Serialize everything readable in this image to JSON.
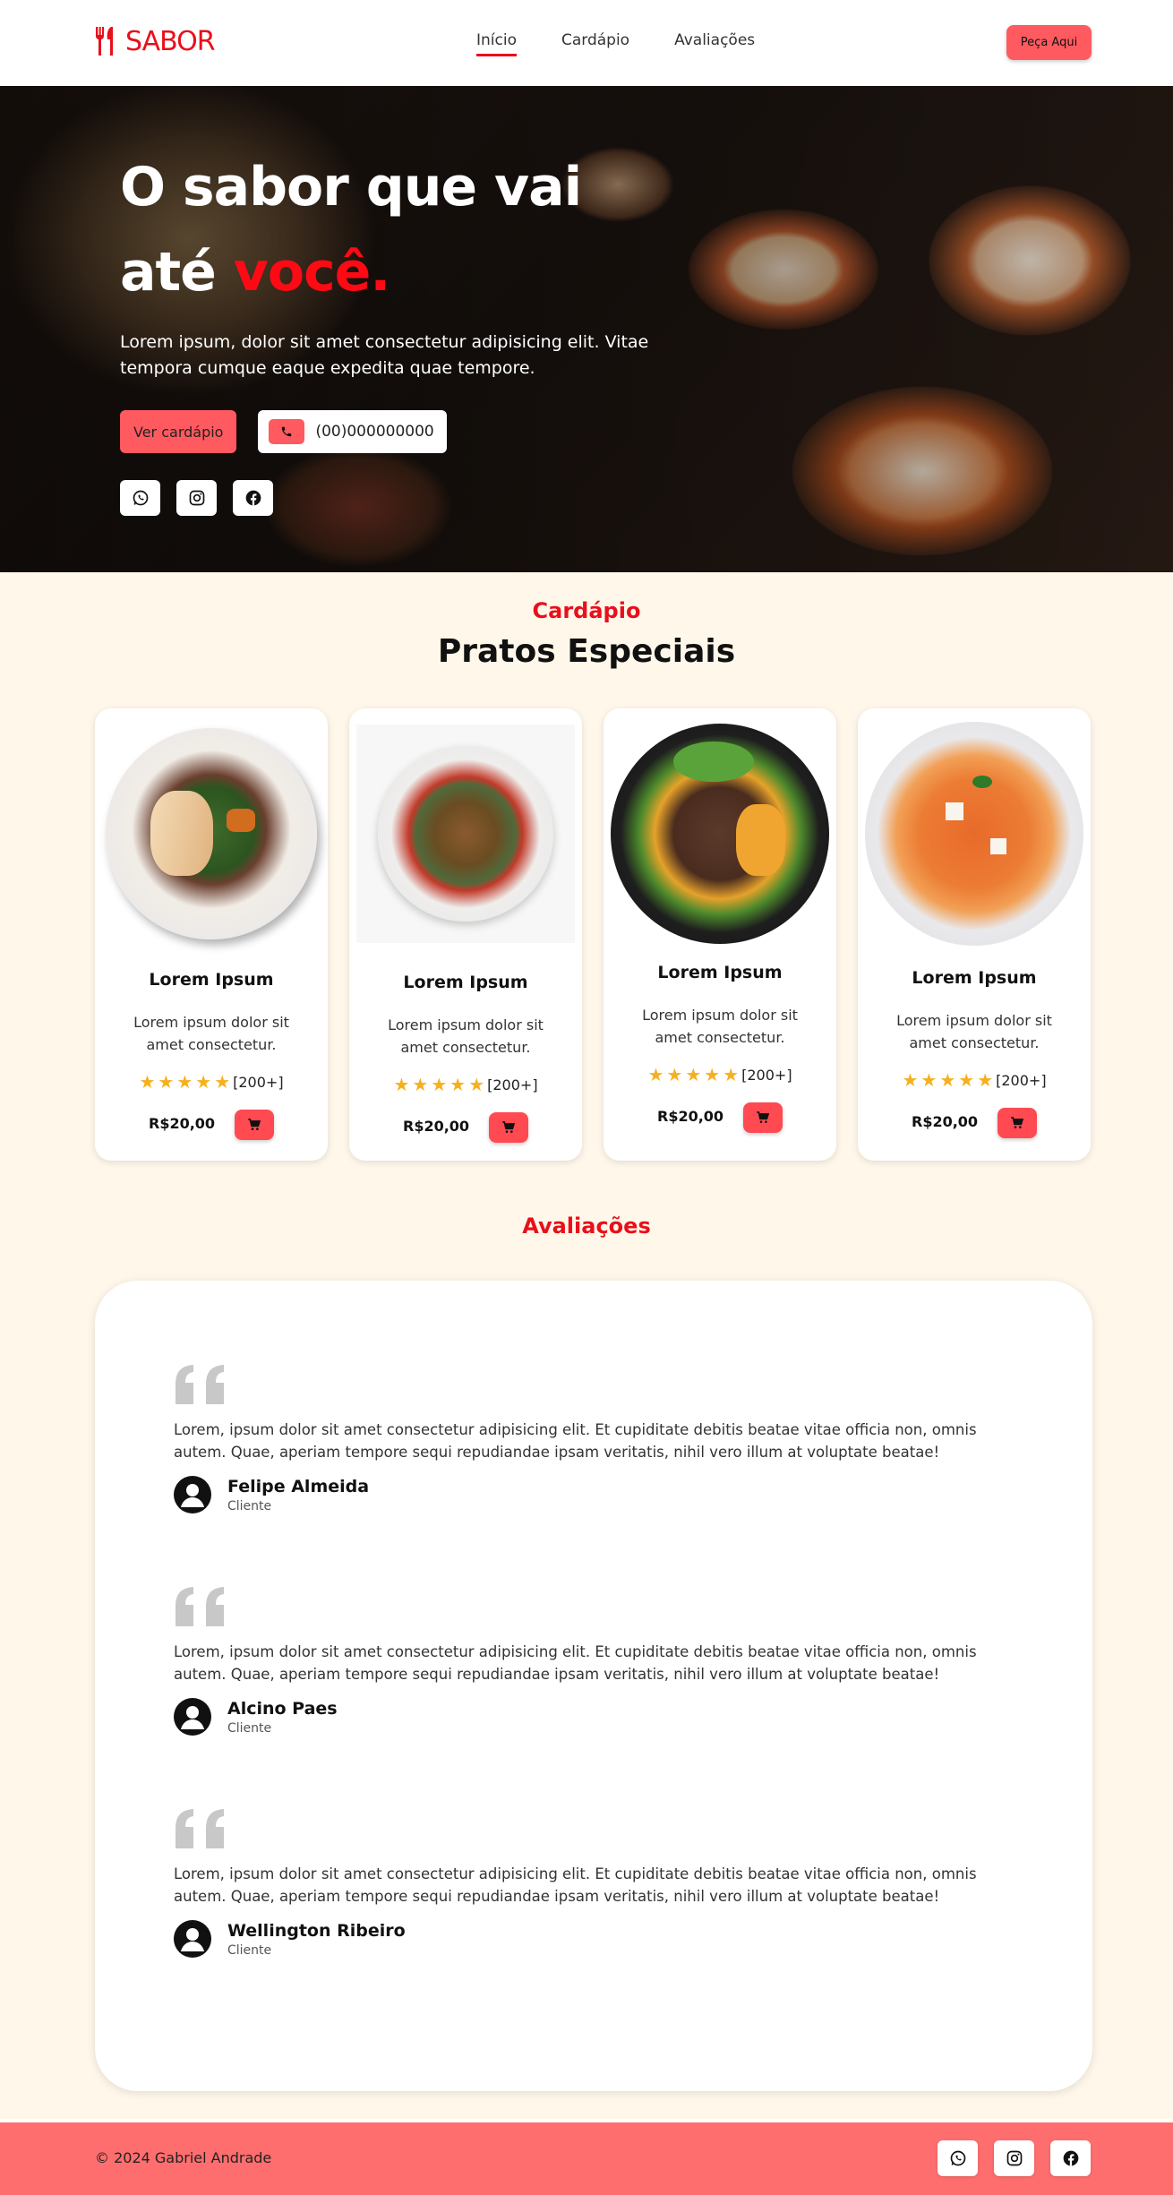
{
  "header": {
    "brand": "SABOR",
    "nav": [
      "Início",
      "Cardápio",
      "Avaliações"
    ],
    "order_button": "Peça Aqui"
  },
  "hero": {
    "title_line1": "O sabor que vai",
    "title_line2_prefix": "até ",
    "title_line2_accent": "você.",
    "description": "Lorem ipsum, dolor sit amet consectetur adipisicing elit. Vitae tempora cumque eaque expedita quae tempore.",
    "menu_button": "Ver cardápio",
    "phone": "(00)000000000",
    "social": [
      "whatsapp-icon",
      "instagram-icon",
      "facebook-icon"
    ]
  },
  "menu_section": {
    "label": "Cardápio",
    "title": "Pratos Especiais",
    "dishes": [
      {
        "name": "Lorem Ipsum",
        "description": "Lorem ipsum dolor sit amet consectetur.",
        "stars": 5,
        "rating_count": "[200+]",
        "price": "R$20,00"
      },
      {
        "name": "Lorem Ipsum",
        "description": "Lorem ipsum dolor sit amet consectetur.",
        "stars": 5,
        "rating_count": "[200+]",
        "price": "R$20,00"
      },
      {
        "name": "Lorem Ipsum",
        "description": "Lorem ipsum dolor sit amet consectetur.",
        "stars": 5,
        "rating_count": "[200+]",
        "price": "R$20,00"
      },
      {
        "name": "Lorem Ipsum",
        "description": "Lorem ipsum dolor sit amet consectetur.",
        "stars": 5,
        "rating_count": "[200+]",
        "price": "R$20,00"
      }
    ]
  },
  "reviews_section": {
    "label": "Avaliações",
    "reviews": [
      {
        "text": "Lorem, ipsum dolor sit amet consectetur adipisicing elit. Et cupiditate debitis beatae vitae officia non, omnis autem. Quae, aperiam tempore sequi repudiandae ipsam veritatis, nihil vero illum at voluptate beatae!",
        "name": "Felipe Almeida",
        "role": "Cliente"
      },
      {
        "text": "Lorem, ipsum dolor sit amet consectetur adipisicing elit. Et cupiditate debitis beatae vitae officia non, omnis autem. Quae, aperiam tempore sequi repudiandae ipsam veritatis, nihil vero illum at voluptate beatae!",
        "name": "Alcino Paes",
        "role": "Cliente"
      },
      {
        "text": "Lorem, ipsum dolor sit amet consectetur adipisicing elit. Et cupiditate debitis beatae vitae officia non, omnis autem. Quae, aperiam tempore sequi repudiandae ipsam veritatis, nihil vero illum at voluptate beatae!",
        "name": "Wellington Ribeiro",
        "role": "Cliente"
      }
    ]
  },
  "footer": {
    "copyright": "© 2024 Gabriel Andrade",
    "social": [
      "whatsapp-icon",
      "instagram-icon",
      "facebook-icon"
    ]
  },
  "colors": {
    "accent": "#e8101b",
    "button": "#ff5a5f",
    "background": "#fff8ea",
    "footer": "#ff6e6e",
    "star": "#f6b01e"
  }
}
